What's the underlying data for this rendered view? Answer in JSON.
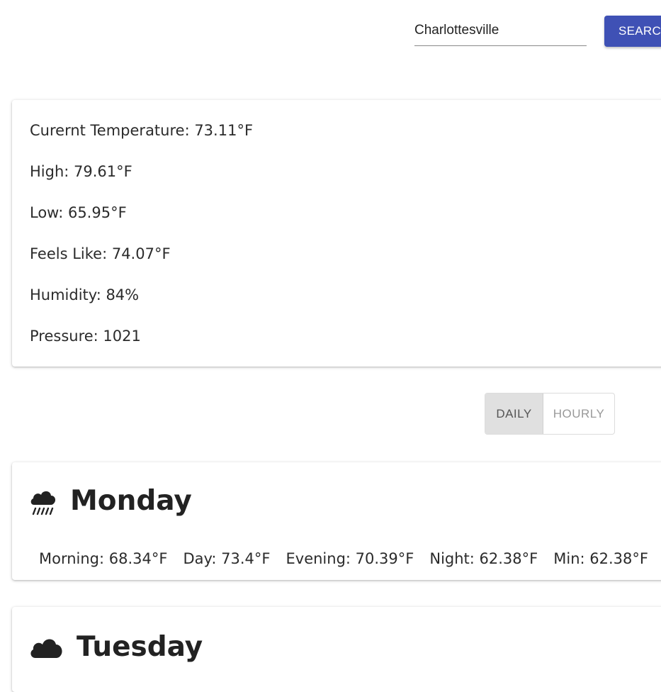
{
  "search": {
    "value": "Charlottesville",
    "button_label": "SEARCH"
  },
  "current": {
    "lines": [
      "Curernt Temperature: 73.11°F",
      "High: 79.61°F",
      "Low: 65.95°F",
      "Feels Like: 74.07°F",
      "Humidity: 84%",
      "Pressure: 1021"
    ]
  },
  "view_toggle": {
    "daily_label": "DAILY",
    "hourly_label": "HOURLY",
    "selected": "DAILY"
  },
  "days": [
    {
      "name": "Monday",
      "icon": "rain-cloud-icon",
      "temps": [
        "Morning: 68.34°F",
        "Day: 73.4°F",
        "Evening: 70.39°F",
        "Night: 62.38°F",
        "Min: 62.38°F"
      ]
    },
    {
      "name": "Tuesday",
      "icon": "cloud-icon"
    }
  ],
  "colors": {
    "accent": "#3f51b5",
    "toggle_selected_bg": "#e0e0e0"
  }
}
